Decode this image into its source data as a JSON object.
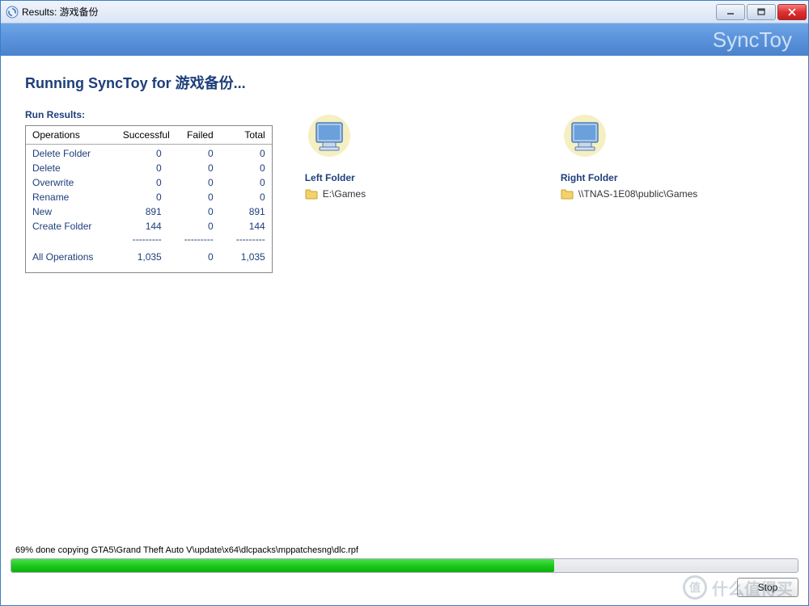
{
  "window": {
    "title": "Results: 游戏备份"
  },
  "brand": "SyncToy",
  "heading": "Running SyncToy for 游戏备份...",
  "results": {
    "label": "Run Results:",
    "headers": {
      "op": "Operations",
      "success": "Successful",
      "failed": "Failed",
      "total": "Total"
    },
    "rows": [
      {
        "op": "Delete Folder",
        "success": "0",
        "failed": "0",
        "total": "0"
      },
      {
        "op": "Delete",
        "success": "0",
        "failed": "0",
        "total": "0"
      },
      {
        "op": "Overwrite",
        "success": "0",
        "failed": "0",
        "total": "0"
      },
      {
        "op": "Rename",
        "success": "0",
        "failed": "0",
        "total": "0"
      },
      {
        "op": "New",
        "success": "891",
        "failed": "0",
        "total": "891"
      },
      {
        "op": "Create Folder",
        "success": "144",
        "failed": "0",
        "total": "144"
      }
    ],
    "dashes": "---------",
    "totals": {
      "op": "All Operations",
      "success": "1,035",
      "failed": "0",
      "total": "1,035"
    }
  },
  "left_folder": {
    "label": "Left Folder",
    "path": "E:\\Games"
  },
  "right_folder": {
    "label": "Right Folder",
    "path": "\\\\TNAS-1E08\\public\\Games"
  },
  "status": "69% done copying GTA5\\Grand Theft Auto V\\update\\x64\\dlcpacks\\mppatchesng\\dlc.rpf",
  "progress_percent": 69,
  "stop_label": "Stop",
  "watermark": "什么值得买"
}
